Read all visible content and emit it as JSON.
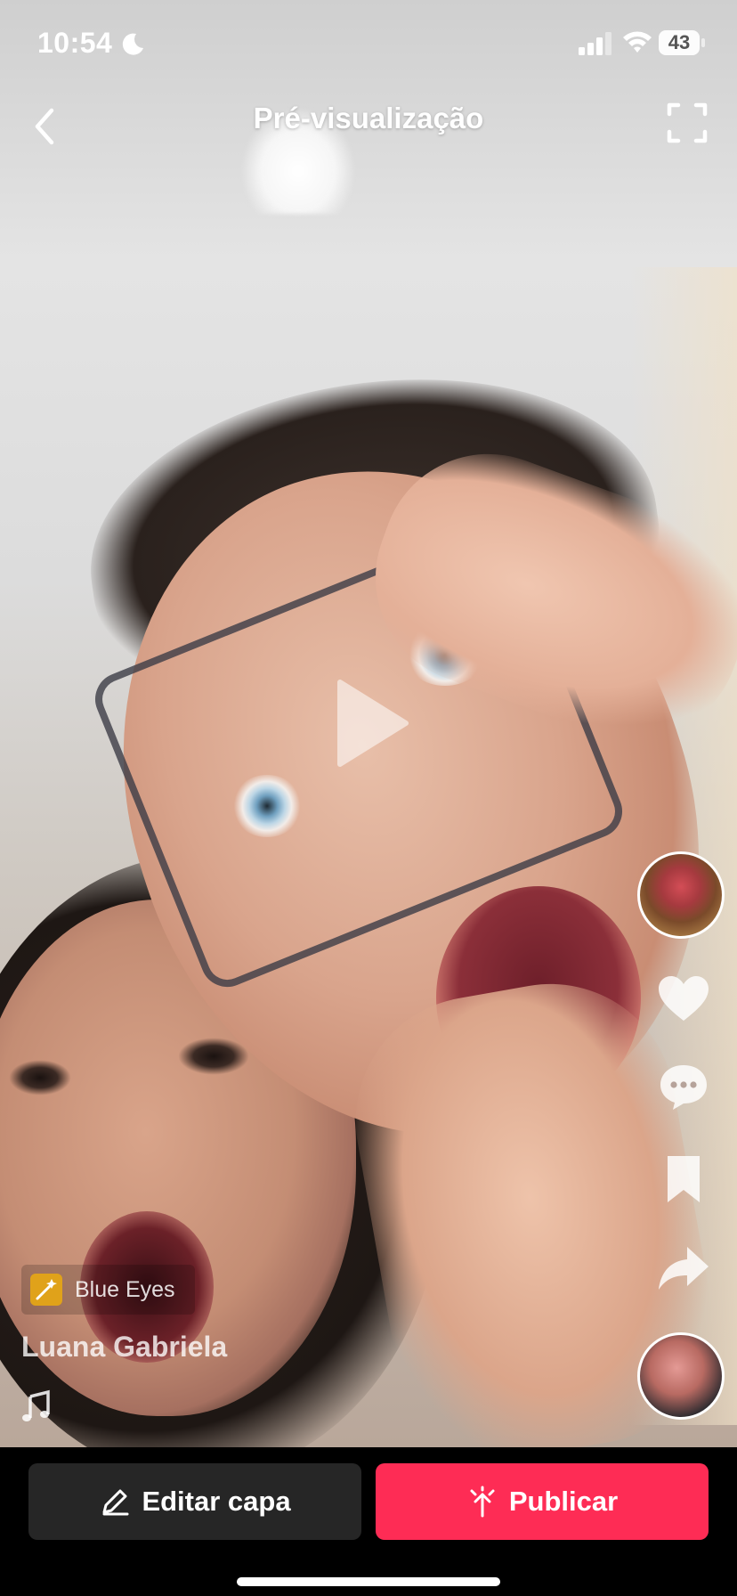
{
  "status_bar": {
    "time": "10:54",
    "battery": "43",
    "moon_icon": "moon-icon",
    "signal_icon": "signal-icon",
    "wifi_icon": "wifi-icon"
  },
  "header": {
    "title": "Pré-visualização",
    "back_icon": "chevron-left-icon",
    "fullscreen_icon": "fullscreen-icon"
  },
  "video": {
    "play_icon": "play-icon"
  },
  "side_actions": {
    "icons": [
      "avatar",
      "heart-icon",
      "comment-icon",
      "bookmark-icon",
      "share-icon",
      "sound-avatar"
    ]
  },
  "caption": {
    "effect_label": "Blue Eyes",
    "username": "Luana Gabriela",
    "music_icon": "music-note-icon"
  },
  "bottom_bar": {
    "edit_cover_label": "Editar capa",
    "publish_label": "Publicar"
  },
  "colors": {
    "publish_button": "#fe2c55",
    "edit_button": "#262626",
    "effect_thumb": "#e0a21a"
  }
}
